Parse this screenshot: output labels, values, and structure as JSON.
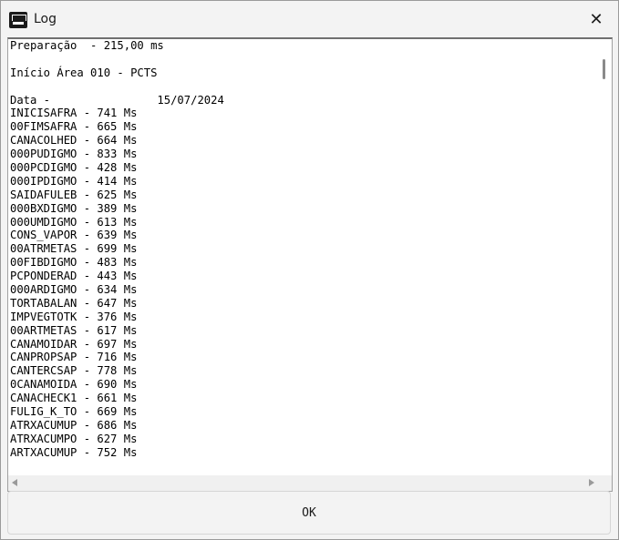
{
  "window": {
    "title": "Log",
    "icons": {
      "app": "app-logo-icon",
      "close": "close-icon"
    }
  },
  "log": {
    "lines": [
      "Preparação  - 215,00 ms",
      "",
      "Início Área 010 - PCTS",
      "",
      "Data -                15/07/2024",
      "INICISAFRA - 741 Ms",
      "00FIMSAFRA - 665 Ms",
      "CANACOLHED - 664 Ms",
      "000PUDIGMO - 833 Ms",
      "000PCDIGMO - 428 Ms",
      "000IPDIGMO - 414 Ms",
      "SAIDAFULEB - 625 Ms",
      "000BXDIGMO - 389 Ms",
      "000UMDIGMO - 613 Ms",
      "CONS_VAPOR - 639 Ms",
      "00ATRMETAS - 699 Ms",
      "00FIBDIGMO - 483 Ms",
      "PCPONDERAD - 443 Ms",
      "000ARDIGMO - 634 Ms",
      "TORTABALAN - 647 Ms",
      "IMPVEGTOTK - 376 Ms",
      "00ARTMETAS - 617 Ms",
      "CANAMOIDAR - 697 Ms",
      "CANPROPSAP - 716 Ms",
      "CANTERCSAP - 778 Ms",
      "0CANAMOIDA - 690 Ms",
      "CANACHECK1 - 661 Ms",
      "FULIG_K_TO - 669 Ms",
      "ATRXACUMUP - 686 Ms",
      "ATRXACUMPO - 627 Ms",
      "ARTXACUMUP - 752 Ms"
    ]
  },
  "buttons": {
    "ok_label": "OK"
  }
}
